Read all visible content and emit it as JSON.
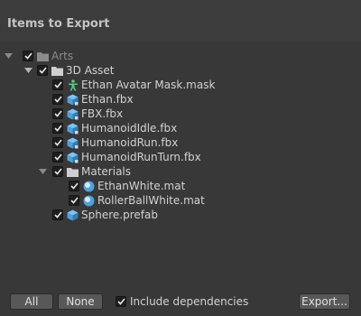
{
  "header": {
    "title": "Items to Export"
  },
  "tree": [
    {
      "label": "Arts",
      "icon": "folder-icon",
      "checked": true,
      "expanded": true,
      "dim": true
    },
    {
      "label": "3D Asset",
      "icon": "folder-icon",
      "checked": true,
      "expanded": true,
      "dim": false
    },
    {
      "label": "Ethan Avatar Mask.mask",
      "icon": "avatar-mask-icon",
      "checked": true,
      "dim": false
    },
    {
      "label": "Ethan.fbx",
      "icon": "prefab-cube-icon",
      "checked": true,
      "dim": false
    },
    {
      "label": "FBX.fbx",
      "icon": "prefab-cube-icon",
      "checked": true,
      "dim": false
    },
    {
      "label": "HumanoidIdle.fbx",
      "icon": "prefab-cube-icon",
      "checked": true,
      "dim": false
    },
    {
      "label": "HumanoidRun.fbx",
      "icon": "prefab-cube-icon",
      "checked": true,
      "dim": false
    },
    {
      "label": "HumanoidRunTurn.fbx",
      "icon": "prefab-cube-icon",
      "checked": true,
      "dim": false
    },
    {
      "label": "Materials",
      "icon": "folder-icon",
      "checked": true,
      "expanded": true,
      "dim": false
    },
    {
      "label": "EthanWhite.mat",
      "icon": "material-sphere-icon",
      "checked": true,
      "dim": false
    },
    {
      "label": "RollerBallWhite.mat",
      "icon": "material-sphere-icon",
      "checked": true,
      "dim": false
    },
    {
      "label": "Sphere.prefab",
      "icon": "prefab-cube-icon",
      "checked": true,
      "dim": false
    }
  ],
  "footer": {
    "all_label": "All",
    "none_label": "None",
    "include_dependencies_label": "Include dependencies",
    "include_dependencies_checked": true,
    "export_label": "Export..."
  },
  "colors": {
    "background": "#383838",
    "text": "#d2d2d2",
    "cube_blue": "#4aa3df",
    "mask_green": "#4cd07d"
  }
}
